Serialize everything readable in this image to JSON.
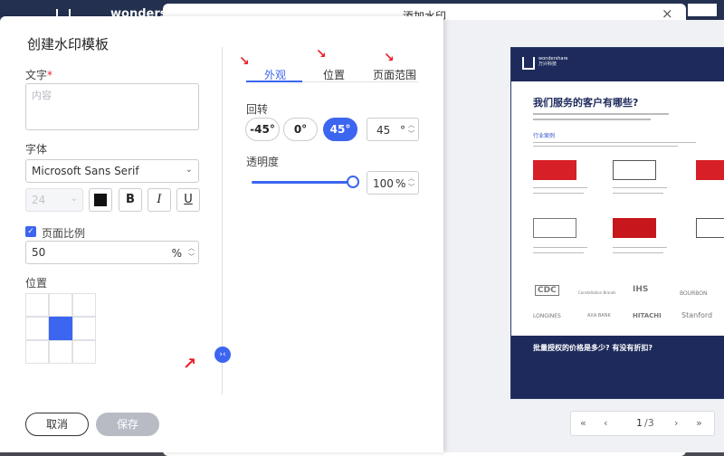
{
  "background": {
    "brand_text": "wondershare"
  },
  "watermark_dialog": {
    "title": "添加水印",
    "close_icon": "×"
  },
  "panel": {
    "title": "创建水印模板",
    "text_label": "文字",
    "required_mark": "*",
    "text_placeholder": "内容",
    "font_label": "字体",
    "font_value": "Microsoft Sans Serif",
    "font_size_value": "24",
    "bold_label": "B",
    "italic_label": "I",
    "underline_label": "U",
    "page_ratio_label": "页面比例",
    "page_ratio_value": "50",
    "page_ratio_unit": "%",
    "position_label": "位置",
    "cancel_label": "取消",
    "save_label": "保存"
  },
  "tabs": [
    {
      "label": "外观",
      "active": true
    },
    {
      "label": "位置",
      "active": false
    },
    {
      "label": "页面范围",
      "active": false
    }
  ],
  "appearance": {
    "rotation_label": "回转",
    "rotation_options": [
      "-45°",
      "0°",
      "45°"
    ],
    "rotation_selected": "45°",
    "rotation_value": "45",
    "rotation_unit": "°",
    "opacity_label": "透明度",
    "opacity_value": "100",
    "opacity_unit": "%"
  },
  "preview": {
    "brand": "wondershare",
    "brand_sub": "万兴科技",
    "heading": "我们服务的客户有哪些?",
    "section_label": "行业案例",
    "logos": [
      "CDC",
      "Constellation Brands",
      "IHS",
      "BOURBON",
      "LONGINES",
      "AXA BANK",
      "HITACHI",
      "Stanford"
    ],
    "footer_title": "批量授权的价格是多少? 有没有折扣?",
    "page_current": "1",
    "page_total": "/3"
  },
  "colors": {
    "accent": "#3c65f0",
    "navy": "#1d2a5b",
    "arrow": "#e8202b"
  }
}
